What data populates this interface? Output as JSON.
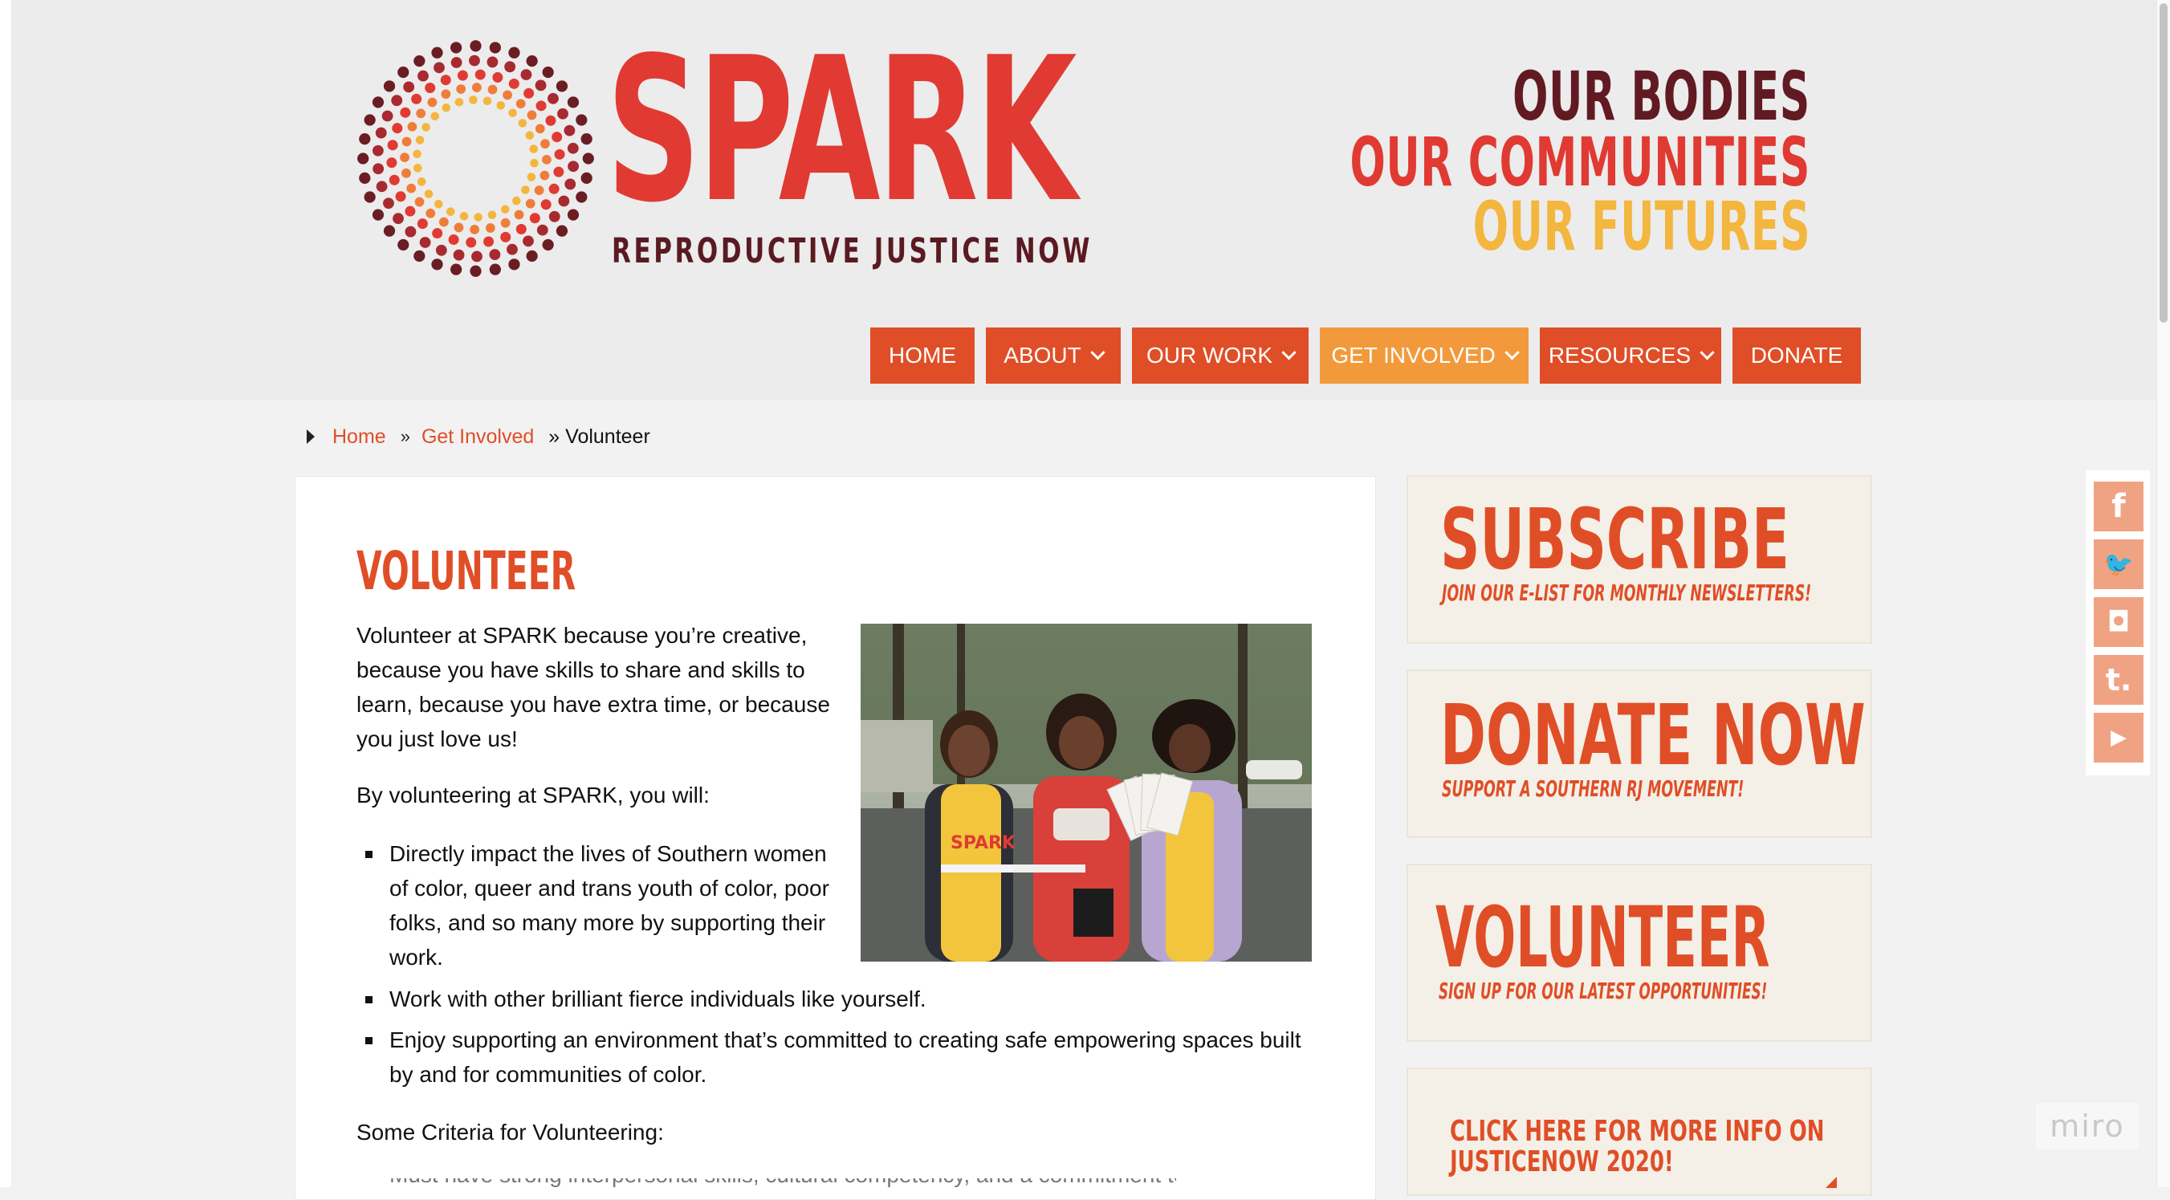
{
  "brand": {
    "name": "SPARK",
    "tagline": "REPRODUCTIVE JUSTICE NOW",
    "slogan": [
      "OUR BODIES",
      "OUR COMMUNITIES",
      "OUR FUTURES"
    ],
    "colors": {
      "red": "#e03a33",
      "orange": "#e04e27",
      "maroon": "#621a22",
      "gold": "#f3b63f",
      "active_nav": "#f29a3b"
    }
  },
  "nav": {
    "items": [
      {
        "label": "HOME",
        "dropdown": false
      },
      {
        "label": "ABOUT",
        "dropdown": true
      },
      {
        "label": "OUR WORK",
        "dropdown": true
      },
      {
        "label": "GET INVOLVED",
        "dropdown": true,
        "active": true
      },
      {
        "label": "RESOURCES",
        "dropdown": true
      },
      {
        "label": "DONATE",
        "dropdown": false
      }
    ]
  },
  "breadcrumb": {
    "home": "Home",
    "sep": "»",
    "parent": "Get Involved",
    "current": "» Volunteer"
  },
  "main": {
    "title": "VOLUNTEER",
    "intro": "Volunteer at SPARK because you’re creative, because you have skills to share and skills to learn, because you have extra time, or because you just love us!",
    "will_heading": "By volunteering at SPARK, you will:",
    "bullets": [
      "Directly impact the lives of Southern women of color, queer and trans youth of color, poor folks, and so many more by supporting their work.",
      "Work with other brilliant fierce individuals like yourself.",
      "Enjoy supporting an environment that’s committed to creating safe empowering spaces built by and for communities of color."
    ],
    "criteria_heading": "Some Criteria for Volunteering:",
    "cutoff_line": "Must have strong interpersonal skills, cultural competency, and a commitment to social justice"
  },
  "sidebar": {
    "widgets": [
      {
        "title": "SUBSCRIBE",
        "subtitle": "JOIN OUR E-LIST FOR MONTHLY NEWSLETTERS!"
      },
      {
        "title": "DONATE NOW",
        "subtitle": "SUPPORT A SOUTHERN RJ MOVEMENT!"
      },
      {
        "title": "VOLUNTEER",
        "subtitle": "SIGN UP FOR OUR LATEST OPPORTUNITIES!"
      },
      {
        "line1": "CLICK HERE FOR MORE INFO ON",
        "line2": "JUSTICENOW 2020!"
      }
    ]
  },
  "social": [
    {
      "icon": "facebook-icon",
      "glyph": "f"
    },
    {
      "icon": "twitter-icon",
      "glyph": "🐦"
    },
    {
      "icon": "instagram-icon",
      "glyph": "◘"
    },
    {
      "icon": "tumblr-icon",
      "glyph": "t."
    },
    {
      "icon": "youtube-icon",
      "glyph": "▶"
    }
  ],
  "watermark": "miro"
}
